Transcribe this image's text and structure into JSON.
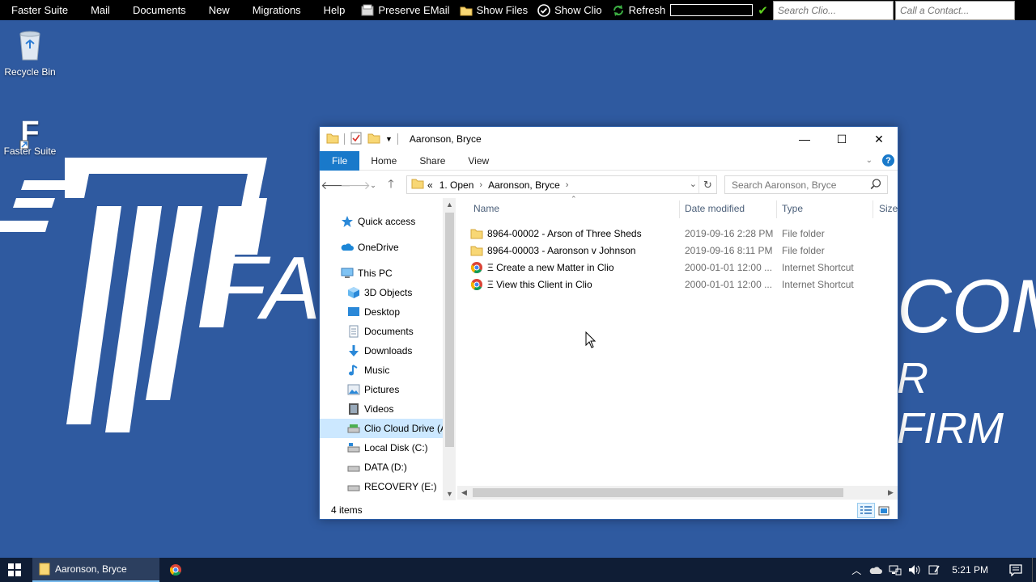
{
  "topbar": {
    "menus": [
      "Faster Suite",
      "Mail",
      "Documents",
      "New",
      "Migrations",
      "Help"
    ],
    "preserve_email": "Preserve EMail",
    "show_files": "Show Files",
    "show_clio": "Show Clio",
    "refresh": "Refresh",
    "search_placeholder": "Search Clio...",
    "call_placeholder": "Call a Contact..."
  },
  "desktop": {
    "recycle_bin": "Recycle Bin",
    "faster_suite": "Faster Suite",
    "wallpaper_text_1": "FA",
    "wallpaper_text_2": "COM",
    "wallpaper_text_3": "R FIRM"
  },
  "window": {
    "title": "Aaronson, Bryce",
    "controls": {
      "minimize": "—",
      "maximize": "☐",
      "close": "✕"
    },
    "ribbon_tabs": [
      "File",
      "Home",
      "Share",
      "View"
    ],
    "address": {
      "overflow": "«",
      "crumbs": [
        "1. Open",
        "Aaronson, Bryce"
      ]
    },
    "search_placeholder": "Search Aaronson, Bryce",
    "nav_items": [
      {
        "label": "Quick access",
        "icon": "star-icon"
      },
      {
        "label": "OneDrive",
        "icon": "cloud-icon"
      },
      {
        "label": "This PC",
        "icon": "computer-icon"
      },
      {
        "label": "3D Objects",
        "icon": "cube-icon"
      },
      {
        "label": "Desktop",
        "icon": "desktop-icon"
      },
      {
        "label": "Documents",
        "icon": "document-icon"
      },
      {
        "label": "Downloads",
        "icon": "download-icon"
      },
      {
        "label": "Music",
        "icon": "music-icon"
      },
      {
        "label": "Pictures",
        "icon": "picture-icon"
      },
      {
        "label": "Videos",
        "icon": "video-icon"
      },
      {
        "label": "Clio Cloud Drive (A",
        "icon": "drive-icon"
      },
      {
        "label": "Local Disk (C:)",
        "icon": "drive-icon"
      },
      {
        "label": "DATA (D:)",
        "icon": "drive-icon"
      },
      {
        "label": "RECOVERY (E:)",
        "icon": "drive-icon"
      }
    ],
    "columns": {
      "name": "Name",
      "date": "Date modified",
      "type": "Type",
      "size": "Size"
    },
    "files": [
      {
        "name": "8964-00002 - Arson of Three Sheds",
        "date": "2019-09-16 2:28 PM",
        "type": "File folder",
        "icon": "folder-icon"
      },
      {
        "name": "8964-00003 - Aaronson v Johnson",
        "date": "2019-09-16 8:11 PM",
        "type": "File folder",
        "icon": "folder-icon"
      },
      {
        "name": "Ξ Create a new Matter in Clio",
        "date": "2000-01-01 12:00 ...",
        "type": "Internet Shortcut",
        "icon": "chrome-icon"
      },
      {
        "name": "Ξ View this Client in Clio",
        "date": "2000-01-01 12:00 ...",
        "type": "Internet Shortcut",
        "icon": "chrome-icon"
      }
    ],
    "status": "4 items"
  },
  "taskbar": {
    "active_task": "Aaronson, Bryce",
    "clock": "5:21 PM"
  },
  "colors": {
    "desktop_bg": "#2f5aa0",
    "ribbon_file": "#1979ca",
    "taskbar": "#0f1d35",
    "check": "#5fd11f"
  }
}
